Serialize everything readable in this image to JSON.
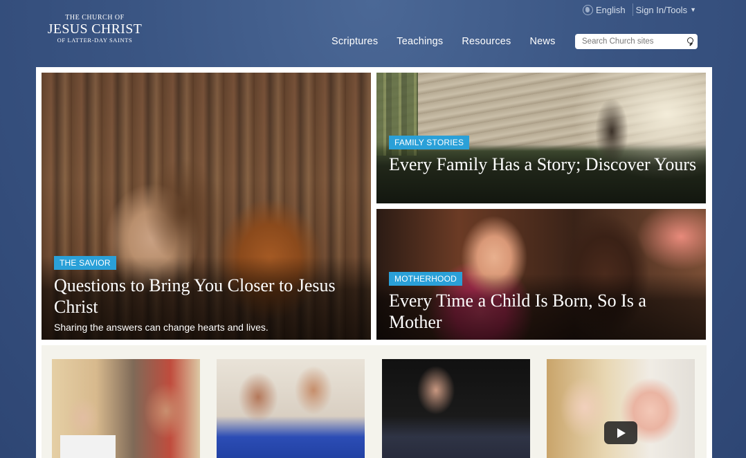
{
  "header": {
    "logo": {
      "line1": "THE CHURCH OF",
      "line2": "JESUS CHRIST",
      "line3": "OF LATTER-DAY SAINTS"
    },
    "utility": {
      "language": "English",
      "signin": "Sign In/Tools"
    },
    "nav": [
      {
        "label": "Scriptures"
      },
      {
        "label": "Teachings"
      },
      {
        "label": "Resources"
      },
      {
        "label": "News"
      }
    ],
    "search": {
      "placeholder": "Search Church sites"
    }
  },
  "features": {
    "main": {
      "tag": "THE SAVIOR",
      "headline": "Questions to Bring You Closer to Jesus Christ",
      "subtitle": "Sharing the answers can change hearts and lives."
    },
    "family": {
      "tag": "FAMILY STORIES",
      "headline": "Every Family Has a Story; Discover Yours"
    },
    "motherhood": {
      "tag": "MOTHERHOOD",
      "headline": "Every Time a Child Is Born, So Is a Mother"
    }
  },
  "colors": {
    "tag": "#2aa0d8",
    "background": "#3a5583"
  }
}
